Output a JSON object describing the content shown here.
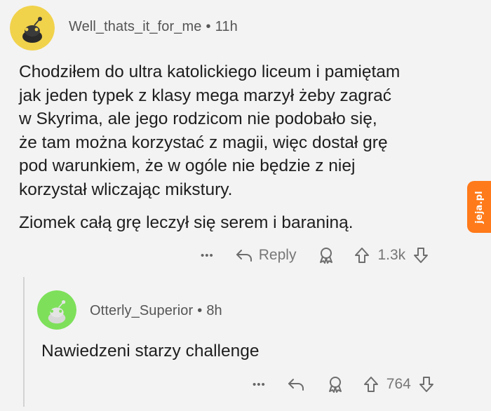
{
  "comment1": {
    "username": "Well_thats_it_for_me",
    "separator": "•",
    "time": "11h",
    "avatar_color": "#f1d24b",
    "paragraph_lines": [
      "Chodziłem do ultra katolickiego liceum i pamiętam",
      "jak jeden typek z klasy mega marzył żeby zagrać",
      "w Skyrima, ale jego rodzicom nie podobało się,",
      "że tam można korzystać z magii, więc dostał grę",
      "pod warunkiem, że w ogóle nie będzie z niej",
      "korzystał wliczając mikstury."
    ],
    "paragraph2": "Ziomek całą grę leczył się serem i baraniną.",
    "actions": {
      "more": "•••",
      "reply_label": "Reply",
      "vote_count": "1.3k"
    }
  },
  "comment2": {
    "username": "Otterly_Superior",
    "separator": "•",
    "time": "8h",
    "avatar_color": "#7ee05a",
    "text": "Nawiedzeni starzy challenge",
    "actions": {
      "more": "•••",
      "vote_count": "764"
    }
  },
  "watermark": {
    "text": "jeja.pl",
    "color": "#ff7a1a"
  },
  "icons": [
    "more-icon",
    "reply-icon",
    "award-icon",
    "upvote-icon",
    "downvote-icon"
  ]
}
